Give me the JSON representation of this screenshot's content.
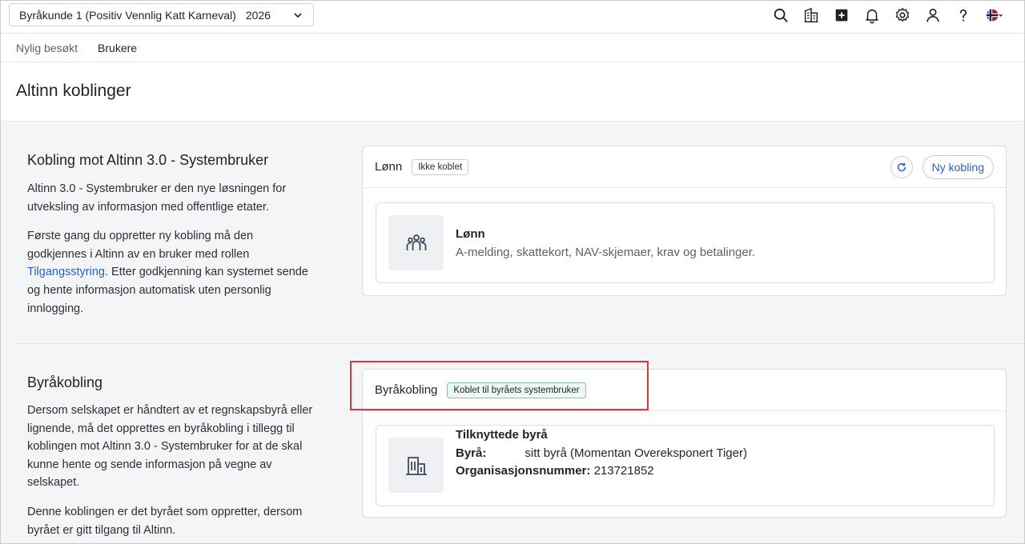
{
  "topbar": {
    "company": "Byråkunde 1 (Positiv Vennlig Katt Karneval)",
    "year": "2026",
    "icons": [
      "search-icon",
      "building-grid-icon",
      "add-square-icon",
      "bell-icon",
      "gear-icon",
      "user-icon",
      "help-icon",
      "flag-norway-icon"
    ]
  },
  "subnav": {
    "items": [
      "Nylig besøkt",
      "Brukere"
    ]
  },
  "page": {
    "title": "Altinn koblinger"
  },
  "section1": {
    "title": "Kobling mot Altinn 3.0 - Systembruker",
    "p1": "Altinn 3.0 - Systembruker er den nye løsningen for utveksling av informasjon med offentlige etater.",
    "p2_pre": "Første gang du oppretter ny kobling må den godkjennes i Altinn av en bruker med rollen ",
    "p2_link": "Tilgangsstyring",
    "p2_post": ". Etter godkjenning kan systemet sende og hente informasjon automatisk uten personlig innlogging."
  },
  "card1": {
    "title": "Lønn",
    "badge": "Ikke koblet",
    "new_button": "Ny kobling",
    "item_title": "Lønn",
    "item_desc": "A-melding, skattekort, NAV-skjemaer, krav og betalinger."
  },
  "section2": {
    "title": "Byråkobling",
    "p1": "Dersom selskapet er håndtert av et regnskapsbyrå eller lignende, må det opprettes en byråkobling i tillegg til koblingen mot Altinn 3.0 - Systembruker for at de skal kunne hente og sende informasjon på vegne av selskapet.",
    "p2": "Denne koblingen er det byrået som oppretter, dersom byrået er gitt tilgang til Altinn."
  },
  "card2": {
    "title": "Byråkobling",
    "badge": "Koblet til byråets systembruker",
    "item_title": "Tilknyttede byrå",
    "agency_label": "Byrå:",
    "agency_value": "sitt byrå (Momentan Overeksponert Tiger)",
    "org_label": "Organisasjonsnummer:",
    "org_value": "213721852"
  },
  "colors": {
    "link": "#2563c9",
    "highlight": "#d8383b",
    "badge_green": "#7ccb95"
  }
}
